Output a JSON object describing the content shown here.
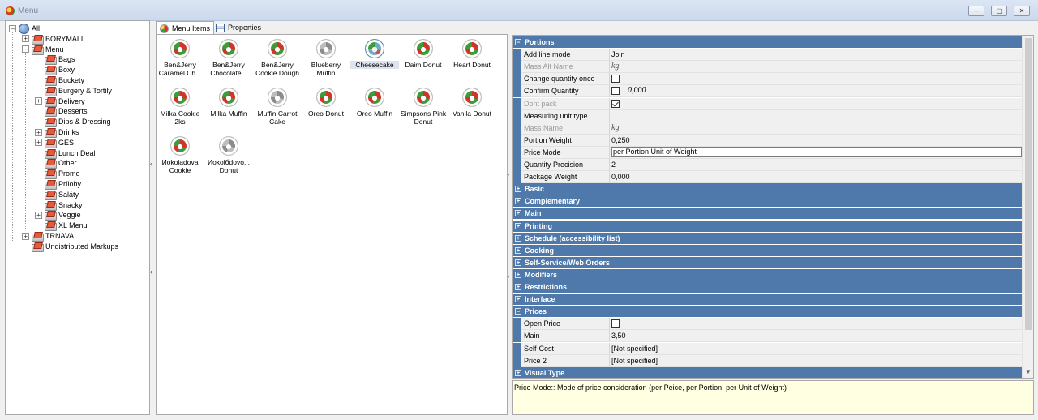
{
  "window": {
    "title": "Menu",
    "controls": [
      "–",
      "▢",
      "✕"
    ]
  },
  "tree": {
    "root": "All",
    "nodes": [
      {
        "label": "BORYMALL",
        "expander": "+"
      },
      {
        "label": "Menu",
        "expander": "–"
      },
      {
        "label": "Bags",
        "expander": ""
      },
      {
        "label": "Boxy",
        "expander": ""
      },
      {
        "label": "Buckety",
        "expander": ""
      },
      {
        "label": "Burgery & Tortily",
        "expander": ""
      },
      {
        "label": "Delivery",
        "expander": "+"
      },
      {
        "label": "Desserts",
        "expander": ""
      },
      {
        "label": "Dips & Dressing",
        "expander": ""
      },
      {
        "label": "Drinks",
        "expander": "+"
      },
      {
        "label": "GES",
        "expander": "+"
      },
      {
        "label": "Lunch Deal",
        "expander": ""
      },
      {
        "label": "Other",
        "expander": ""
      },
      {
        "label": "Promo",
        "expander": ""
      },
      {
        "label": "Prílohy",
        "expander": ""
      },
      {
        "label": "Saláty",
        "expander": ""
      },
      {
        "label": "Snacky",
        "expander": ""
      },
      {
        "label": "Veggie",
        "expander": "+"
      },
      {
        "label": "XL Menu",
        "expander": ""
      },
      {
        "label": "TRNAVA",
        "expander": "+"
      },
      {
        "label": "Undistributed Markups",
        "expander": ""
      }
    ]
  },
  "tabs": [
    {
      "label": "Menu Items",
      "icon": "menu-items-icon"
    },
    {
      "label": "Properties",
      "icon": "properties-icon"
    }
  ],
  "items": [
    {
      "label": "Ben&Jerry Caramel Ch...",
      "style": "color"
    },
    {
      "label": "Ben&Jerry Chocolate...",
      "style": "color"
    },
    {
      "label": "Ben&Jerry Cookie Dough",
      "style": "color"
    },
    {
      "label": "Blueberry Muffin",
      "style": "gray"
    },
    {
      "label": "Cheesecake",
      "style": "selected"
    },
    {
      "label": "Daim Donut",
      "style": "color"
    },
    {
      "label": "Heart Donut",
      "style": "color"
    },
    {
      "label": "Milka Cookie 2ks",
      "style": "color"
    },
    {
      "label": "Milka Muffin",
      "style": "color"
    },
    {
      "label": "Muffin Carrot Cake",
      "style": "gray"
    },
    {
      "label": "Oreo Donut",
      "style": "color"
    },
    {
      "label": "Oreo Muffin",
      "style": "color"
    },
    {
      "label": "Simpsons Pink Donut",
      "style": "color"
    },
    {
      "label": "Vanila Donut",
      "style": "color"
    },
    {
      "label": "Иokoladova Cookie",
      "style": "color"
    },
    {
      "label": "Иokolбdovo... Donut",
      "style": "gray"
    }
  ],
  "properties": {
    "portions": {
      "title": "Portions",
      "toggle": "–",
      "rows": [
        {
          "name": "Add line mode",
          "value": "Join",
          "disabled": false
        },
        {
          "name": "Mass Alt Name",
          "value": "kg",
          "disabled": true,
          "italic": true
        },
        {
          "name": "Change quantity once",
          "value": "",
          "disabled": false,
          "checkbox": false
        },
        {
          "name": "Confirm Quantity",
          "value": "0,000",
          "disabled": false,
          "checkbox": false,
          "italic": true
        },
        {
          "name": "Dont pack",
          "value": "",
          "disabled": true,
          "checkbox": true
        },
        {
          "name": "Measuring unit type",
          "value": "",
          "disabled": false
        },
        {
          "name": "Mass Name",
          "value": "kg",
          "disabled": true,
          "italic": true
        },
        {
          "name": "Portion Weight",
          "value": "0,250",
          "disabled": false
        },
        {
          "name": "Price Mode",
          "value": "per Portion Unit of Weight",
          "disabled": false,
          "editing": true
        },
        {
          "name": "Quantity Precision",
          "value": "2",
          "disabled": false
        },
        {
          "name": "Package Weight",
          "value": "0,000",
          "disabled": false
        }
      ]
    },
    "collapsed": [
      "Basic",
      "Complementary",
      "Main",
      "Printing",
      "Schedule (accessibility list)",
      "Cooking",
      "Self-Service/Web Orders",
      "Modifiers",
      "Restrictions",
      "Interface"
    ],
    "prices": {
      "title": "Prices",
      "toggle": "–",
      "rows": [
        {
          "name": "Open Price",
          "value": "",
          "checkbox": false
        },
        {
          "name": "Main",
          "value": "3,50"
        },
        {
          "name": "Self-Cost",
          "value": "[Not specified]"
        },
        {
          "name": "Price 2",
          "value": "[Not specified]"
        }
      ]
    },
    "last": "Visual Type"
  },
  "help_text": "Price Mode:: Mode of price consideration (per Peice, per Portion, per Unit of Weight)",
  "colors": {
    "category_bg": "#4f79aa",
    "help_bg": "#ffffe1",
    "titlebar": "#cbd9ec"
  }
}
